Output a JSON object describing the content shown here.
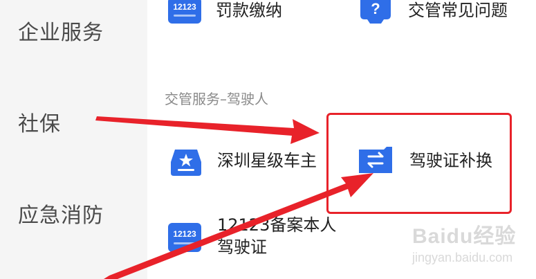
{
  "sidebar": {
    "items": [
      {
        "label": "企业服务"
      },
      {
        "label": "社保"
      },
      {
        "label": "应急消防"
      }
    ]
  },
  "main": {
    "top_row": [
      {
        "label": "罚款缴纳",
        "icon": "12123-app-icon"
      },
      {
        "label": "交管常见问题",
        "icon": "question-icon"
      }
    ],
    "section_title": "交管服务–驾驶人",
    "driver_items": [
      {
        "label": "深圳星级车主",
        "icon": "star-car-icon"
      },
      {
        "label": "驾驶证补换",
        "icon": "swap-icon"
      },
      {
        "label_line1": "12123备案本人",
        "label_line2": "驾驶证",
        "icon": "12123-app-icon"
      }
    ],
    "icon_text": "12123"
  },
  "watermark": {
    "main": "Baidu经验",
    "sub": "jingyan.baidu.com"
  },
  "colors": {
    "accent_blue": "#2f6ee8",
    "annotation_red": "#e8222a",
    "sidebar_bg": "#f5f5f5"
  }
}
